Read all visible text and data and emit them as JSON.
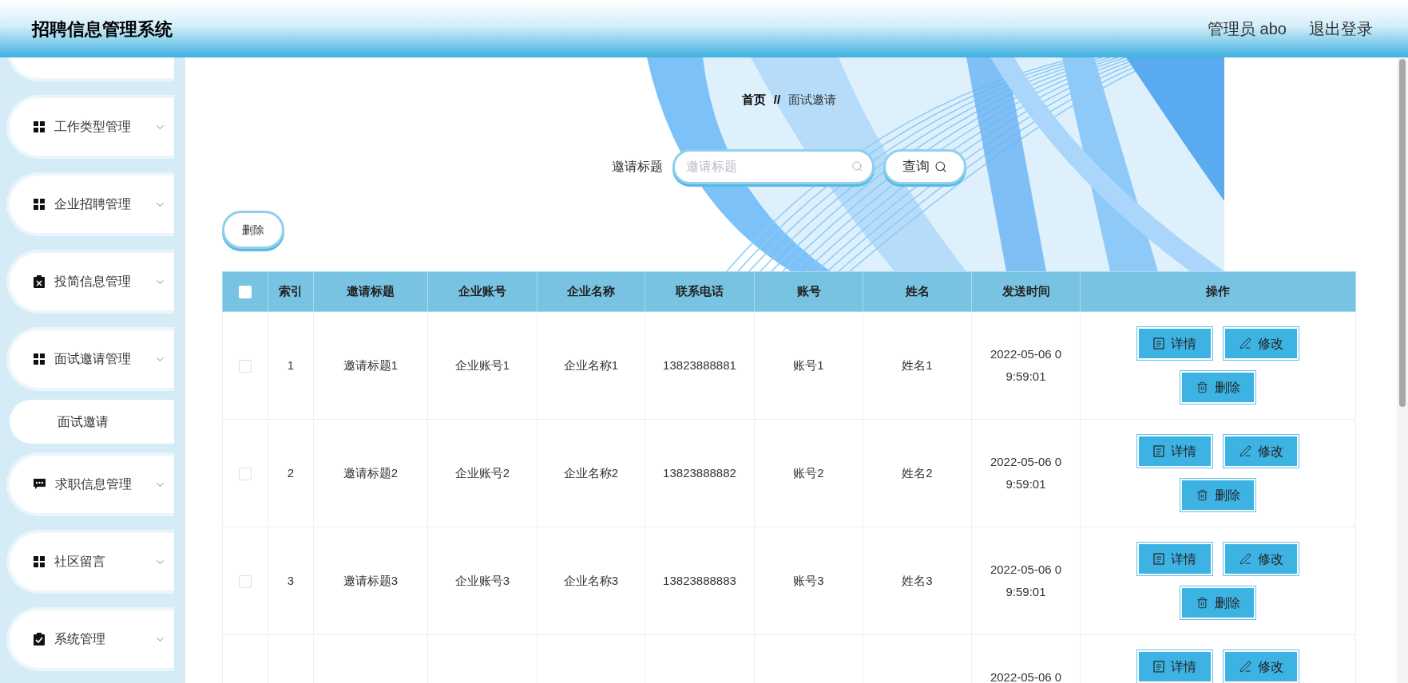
{
  "header": {
    "title": "招聘信息管理系统",
    "user": "管理员 abo",
    "logout": "退出登录"
  },
  "sidebar": {
    "items": [
      {
        "label": "工作类型管理"
      },
      {
        "label": "企业招聘管理"
      },
      {
        "label": "投简信息管理"
      },
      {
        "label": "面试邀请管理",
        "children": [
          {
            "label": "面试邀请"
          }
        ]
      },
      {
        "label": "求职信息管理"
      },
      {
        "label": "社区留言"
      },
      {
        "label": "系统管理"
      }
    ]
  },
  "breadcrumb": {
    "home": "首页",
    "separator": "//",
    "current": "面试邀请"
  },
  "search": {
    "label": "邀请标题",
    "placeholder": "邀请标题",
    "button": "查询"
  },
  "toolbar": {
    "delete": "删除"
  },
  "table": {
    "select_all": {
      "checked": false
    },
    "columns": [
      "索引",
      "邀请标题",
      "企业账号",
      "企业名称",
      "联系电话",
      "账号",
      "姓名",
      "发送时间",
      "操作"
    ],
    "rows": [
      {
        "checked": false,
        "index": "1",
        "title": "邀请标题1",
        "company_account": "企业账号1",
        "company_name": "企业名称1",
        "phone": "13823888881",
        "account": "账号1",
        "name": "姓名1",
        "sent_time": "2022-05-06 09:59:01",
        "actions": [
          "详情",
          "修改",
          "删除"
        ]
      },
      {
        "checked": false,
        "index": "2",
        "title": "邀请标题2",
        "company_account": "企业账号2",
        "company_name": "企业名称2",
        "phone": "13823888882",
        "account": "账号2",
        "name": "姓名2",
        "sent_time": "2022-05-06 09:59:01",
        "actions": [
          "详情",
          "修改",
          "删除"
        ]
      },
      {
        "checked": false,
        "index": "3",
        "title": "邀请标题3",
        "company_account": "企业账号3",
        "company_name": "企业名称3",
        "phone": "13823888883",
        "account": "账号3",
        "name": "姓名3",
        "sent_time": "2022-05-06 09:59:01",
        "actions": [
          "详情",
          "修改",
          "删除"
        ]
      },
      {
        "sent_time": "2022-05-06 0",
        "actions": [
          "详情",
          "修改"
        ]
      }
    ]
  }
}
